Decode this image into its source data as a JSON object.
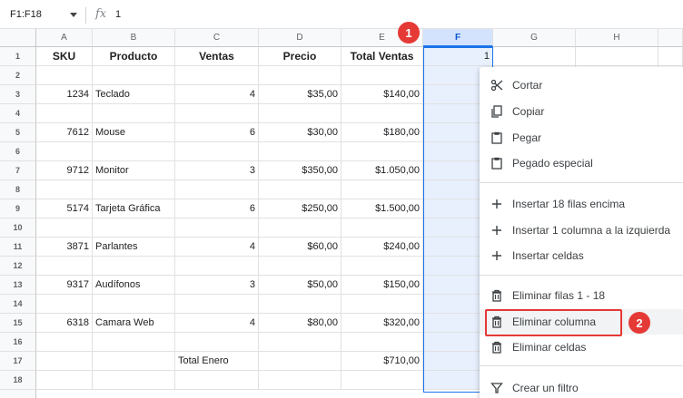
{
  "formula_bar": {
    "name_box": "F1:F18",
    "fx_symbol": "fx",
    "value": "1"
  },
  "columns": [
    "A",
    "B",
    "C",
    "D",
    "E",
    "F",
    "G",
    "H"
  ],
  "rows": [
    "1",
    "2",
    "3",
    "4",
    "5",
    "6",
    "7",
    "8",
    "9",
    "10",
    "11",
    "12",
    "13",
    "14",
    "15",
    "16",
    "17",
    "18"
  ],
  "headers": {
    "sku": "SKU",
    "producto": "Producto",
    "ventas": "Ventas",
    "precio": "Precio",
    "total": "Total Ventas"
  },
  "f1_value": "1",
  "products": [
    {
      "sku": "1234",
      "name": "Teclado",
      "ventas": "4",
      "precio": "$35,00",
      "total": "$140,00"
    },
    {
      "sku": "7612",
      "name": "Mouse",
      "ventas": "6",
      "precio": "$30,00",
      "total": "$180,00"
    },
    {
      "sku": "9712",
      "name": "Monitor",
      "ventas": "3",
      "precio": "$350,00",
      "total": "$1.050,00"
    },
    {
      "sku": "5174",
      "name": "Tarjeta Gráfica",
      "ventas": "6",
      "precio": "$250,00",
      "total": "$1.500,00"
    },
    {
      "sku": "3871",
      "name": "Parlantes",
      "ventas": "4",
      "precio": "$60,00",
      "total": "$240,00"
    },
    {
      "sku": "9317",
      "name": "Audífonos",
      "ventas": "3",
      "precio": "$50,00",
      "total": "$150,00"
    },
    {
      "sku": "6318",
      "name": "Camara Web",
      "ventas": "4",
      "precio": "$80,00",
      "total": "$320,00"
    }
  ],
  "summary": {
    "label": "Total Enero",
    "value": "$710,00"
  },
  "badges": {
    "one": "1",
    "two": "2"
  },
  "menu": {
    "items": [
      {
        "label": "Cortar",
        "icon": "scissors-icon"
      },
      {
        "label": "Copiar",
        "icon": "copy-icon"
      },
      {
        "label": "Pegar",
        "icon": "clipboard-icon"
      },
      {
        "label": "Pegado especial",
        "icon": "clipboard-icon"
      },
      {
        "label": "Insertar 18 filas encima",
        "icon": "plus-icon"
      },
      {
        "label": "Insertar 1 columna a la izquierda",
        "icon": "plus-icon"
      },
      {
        "label": "Insertar celdas",
        "icon": "plus-icon"
      },
      {
        "label": "Eliminar filas 1 - 18",
        "icon": "trash-icon"
      },
      {
        "label": "Eliminar columna",
        "icon": "trash-icon"
      },
      {
        "label": "Eliminar celdas",
        "icon": "trash-icon"
      },
      {
        "label": "Crear un filtro",
        "icon": "filter-icon"
      }
    ],
    "highlighted": "Eliminar columna"
  },
  "colors": {
    "selection": "#1a73e8",
    "selection_fill": "#e8f0fe",
    "badge": "#e53935"
  }
}
